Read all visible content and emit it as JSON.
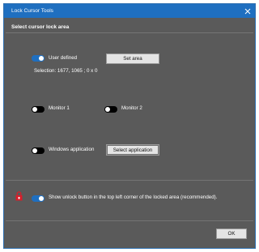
{
  "window": {
    "title": "Lock Cursor Tools"
  },
  "heading": "Select cursor lock area",
  "user_defined": {
    "label": "User defined",
    "enabled": true,
    "button": "Set area",
    "selection": "Selection: 1677, 1065 ; 0 x 0"
  },
  "monitor1": {
    "label": "Monitor 1",
    "enabled": false
  },
  "monitor2": {
    "label": "Monitor 2",
    "enabled": false
  },
  "windows_app": {
    "label": "Windows application",
    "enabled": false,
    "button": "Select application"
  },
  "unlock_option": {
    "label": "Show unlock button in the top left corner of the locked area (recommended).",
    "enabled": true
  },
  "ok_button": "OK",
  "colors": {
    "accent": "#1f6fc0",
    "background": "#5a5a5a",
    "lock_icon": "#d81e2a"
  },
  "icons": {
    "close": "close-icon",
    "lock": "lock-icon"
  }
}
